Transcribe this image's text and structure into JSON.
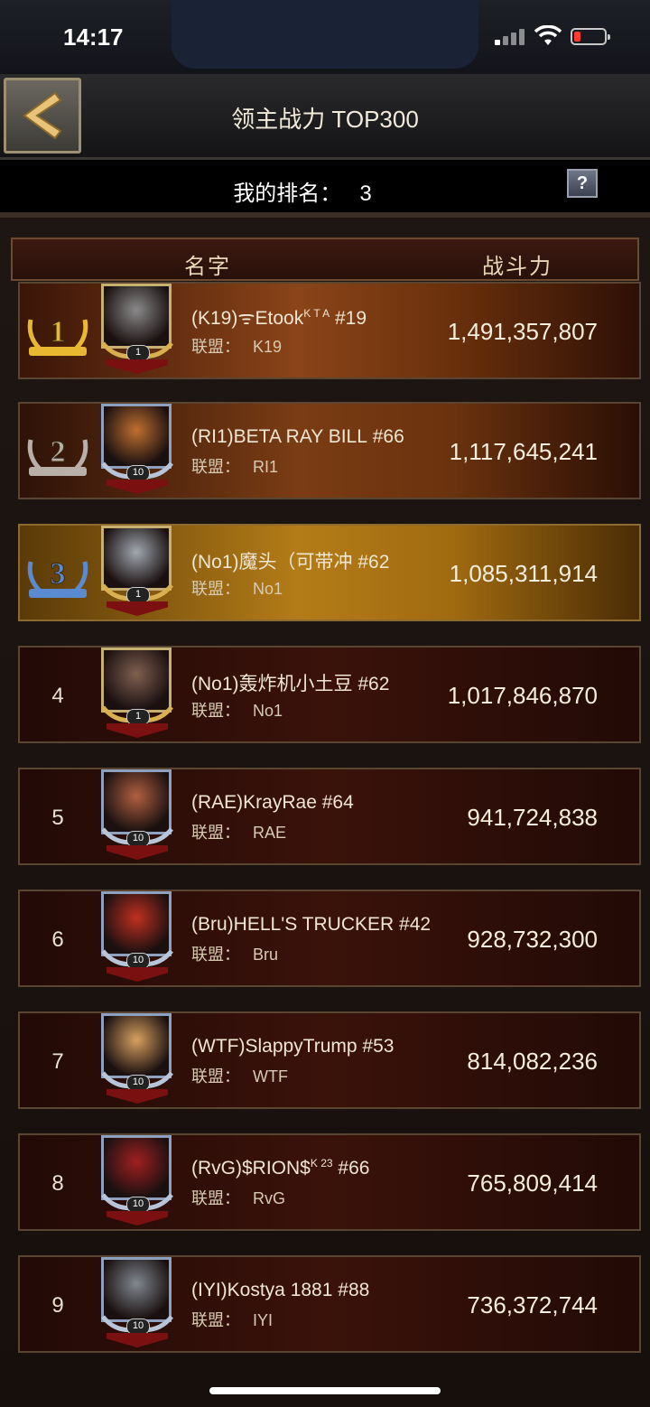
{
  "status": {
    "time": "14:17"
  },
  "header": {
    "title": "领主战力 TOP300"
  },
  "my_rank": {
    "label": "我的排名：",
    "value": "3",
    "help": "?"
  },
  "columns": {
    "name": "名字",
    "power": "战斗力"
  },
  "rows": [
    {
      "rank": "1",
      "name": "(K19)ᯤEtook",
      "sup": "K T A",
      "server": "#19",
      "alliance_label": "联盟：",
      "alliance": "K19",
      "power": "1,491,357,807",
      "level": "1"
    },
    {
      "rank": "2",
      "name": "(RI1)BETA RAY BILL",
      "sup": "",
      "server": "#66",
      "alliance_label": "联盟：",
      "alliance": "RI1",
      "power": "1,117,645,241",
      "level": "10"
    },
    {
      "rank": "3",
      "name": "(No1)魔头（可带冲",
      "sup": "",
      "server": "#62",
      "alliance_label": "联盟：",
      "alliance": "No1",
      "power": "1,085,311,914",
      "level": "1"
    },
    {
      "rank": "4",
      "name": "(No1)轰炸机小土豆",
      "sup": "",
      "server": "#62",
      "alliance_label": "联盟：",
      "alliance": "No1",
      "power": "1,017,846,870",
      "level": "1"
    },
    {
      "rank": "5",
      "name": "(RAE)KrayRae",
      "sup": "",
      "server": "#64",
      "alliance_label": "联盟：",
      "alliance": "RAE",
      "power": "941,724,838",
      "level": "10"
    },
    {
      "rank": "6",
      "name": "(Bru)HELL'S TRUCKER",
      "sup": "",
      "server": "#42",
      "alliance_label": "联盟：",
      "alliance": "Bru",
      "power": "928,732,300",
      "level": "10"
    },
    {
      "rank": "7",
      "name": "(WTF)SlappyTrump",
      "sup": "",
      "server": "#53",
      "alliance_label": "联盟：",
      "alliance": "WTF",
      "power": "814,082,236",
      "level": "10"
    },
    {
      "rank": "8",
      "name": "(RvG)$RION$",
      "sup": "K 23",
      "server": "#66",
      "alliance_label": "联盟：",
      "alliance": "RvG",
      "power": "765,809,414",
      "level": "10"
    },
    {
      "rank": "9",
      "name": "(IYI)Kostya 1881",
      "sup": "",
      "server": "#88",
      "alliance_label": "联盟：",
      "alliance": "IYI",
      "power": "736,372,744",
      "level": "10"
    }
  ],
  "icons": {
    "back": "back-arrow-icon",
    "help": "question-icon"
  },
  "colors": {
    "gold": "#c8a040",
    "panel": "#1e1612",
    "rank3": "#b47c18"
  }
}
